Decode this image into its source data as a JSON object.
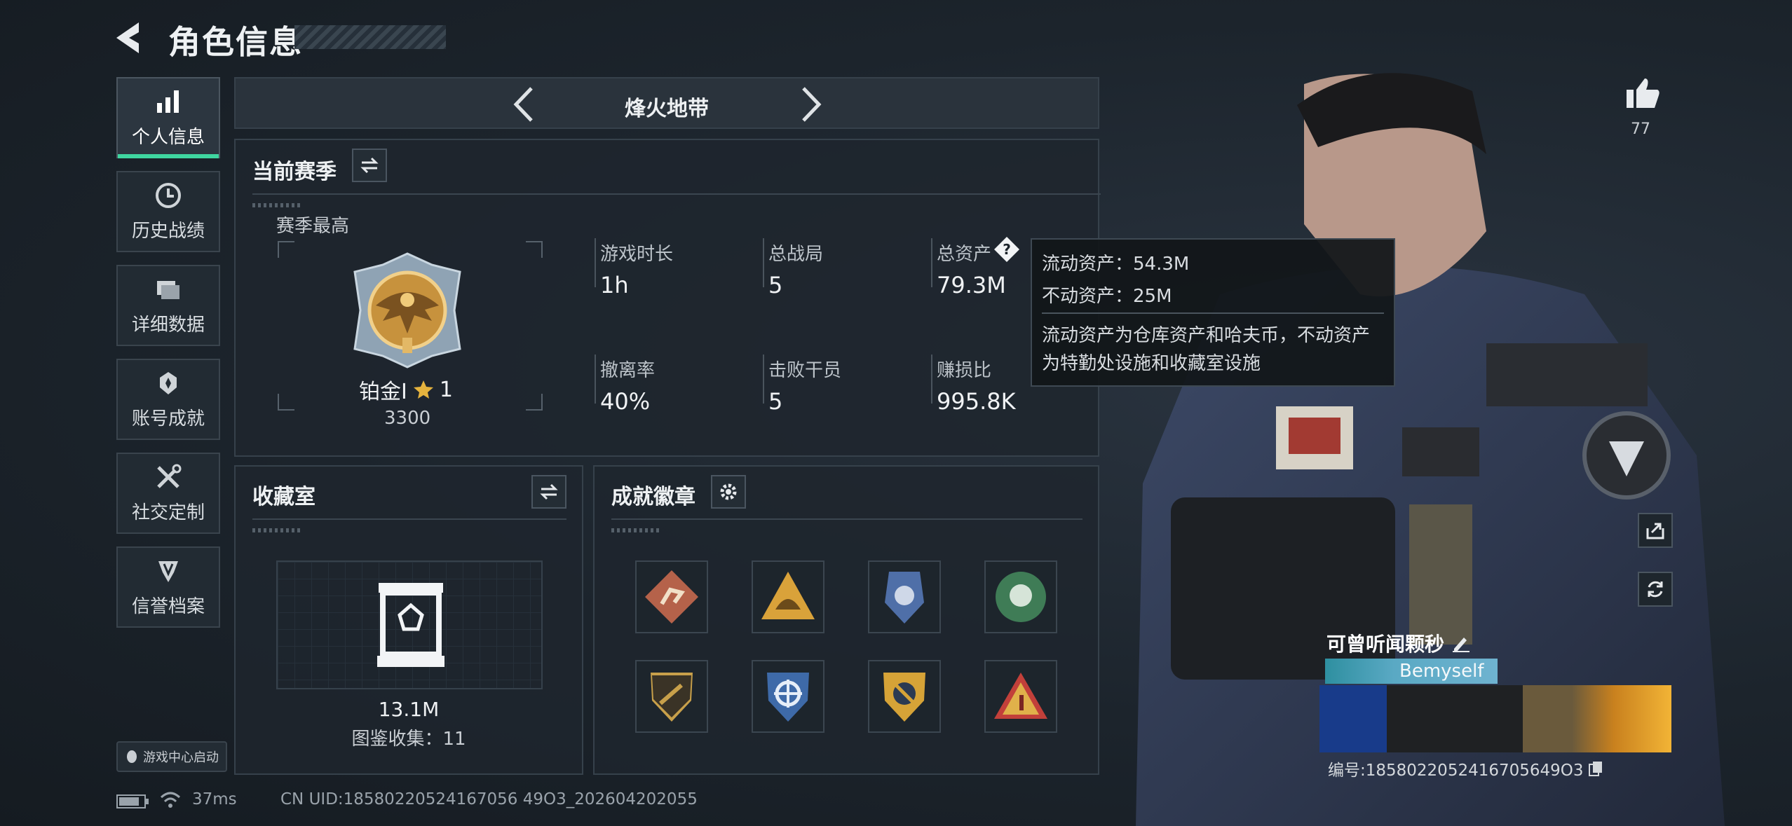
{
  "header": {
    "title": "角色信息"
  },
  "sidebar": {
    "items": [
      {
        "label": "个人信息",
        "icon": "bar-chart-icon",
        "active": true
      },
      {
        "label": "历史战绩",
        "icon": "clock-icon"
      },
      {
        "label": "详细数据",
        "icon": "folder-icon"
      },
      {
        "label": "账号成就",
        "icon": "trophy-icon"
      },
      {
        "label": "社交定制",
        "icon": "tools-icon"
      },
      {
        "label": "信誉档案",
        "icon": "shield-badge-icon"
      }
    ],
    "launch_label": "游戏中心启动"
  },
  "mode_bar": {
    "title": "烽火地带"
  },
  "season": {
    "title": "当前赛季",
    "best_label": "赛季最高",
    "rank_name": "铂金I",
    "rank_stars": "1",
    "rank_score": "3300",
    "stats": [
      {
        "label": "游戏时长",
        "value": "1h"
      },
      {
        "label": "总战局",
        "value": "5"
      },
      {
        "label": "总资产",
        "value": "79.3M"
      },
      {
        "label": "撤离率",
        "value": "40%"
      },
      {
        "label": "击败干员",
        "value": "5"
      },
      {
        "label": "赚损比",
        "value": "995.8K"
      }
    ]
  },
  "tooltip": {
    "liquid": "流动资产：54.3M",
    "fixed": "不动资产：25M",
    "desc_line1": "流动资产为仓库资产和哈夫币，不动资产",
    "desc_line2": "为特勤处设施和收藏室设施"
  },
  "collection": {
    "title": "收藏室",
    "value": "13.1M",
    "catalog": "图鉴收集：11"
  },
  "achievements": {
    "title": "成就徽章",
    "badges": [
      {
        "icon": "runner-badge-icon",
        "color": "#b5624a"
      },
      {
        "icon": "helmet-badge-icon",
        "color": "#d9a23a"
      },
      {
        "icon": "police-badge-icon",
        "color": "#4f6fa8"
      },
      {
        "icon": "rose-badge-icon",
        "color": "#3f7c56"
      },
      {
        "icon": "rifle-shield-badge-icon",
        "color": "#c8a04a"
      },
      {
        "icon": "crosshair-shield-badge-icon",
        "color": "#3e6aa8"
      },
      {
        "icon": "golden-target-badge-icon",
        "color": "#d6a337"
      },
      {
        "icon": "triangle-badge-icon",
        "color": "#c2403a"
      }
    ]
  },
  "profile": {
    "likes": "77",
    "name": "可曾听闻颗秒",
    "plate_name": "Bemyself",
    "uid": "编号:1858022052416705649O3"
  },
  "status": {
    "ping": "37ms",
    "uid_line": "CN UID:18580220524167056 49O3_202604202055"
  }
}
